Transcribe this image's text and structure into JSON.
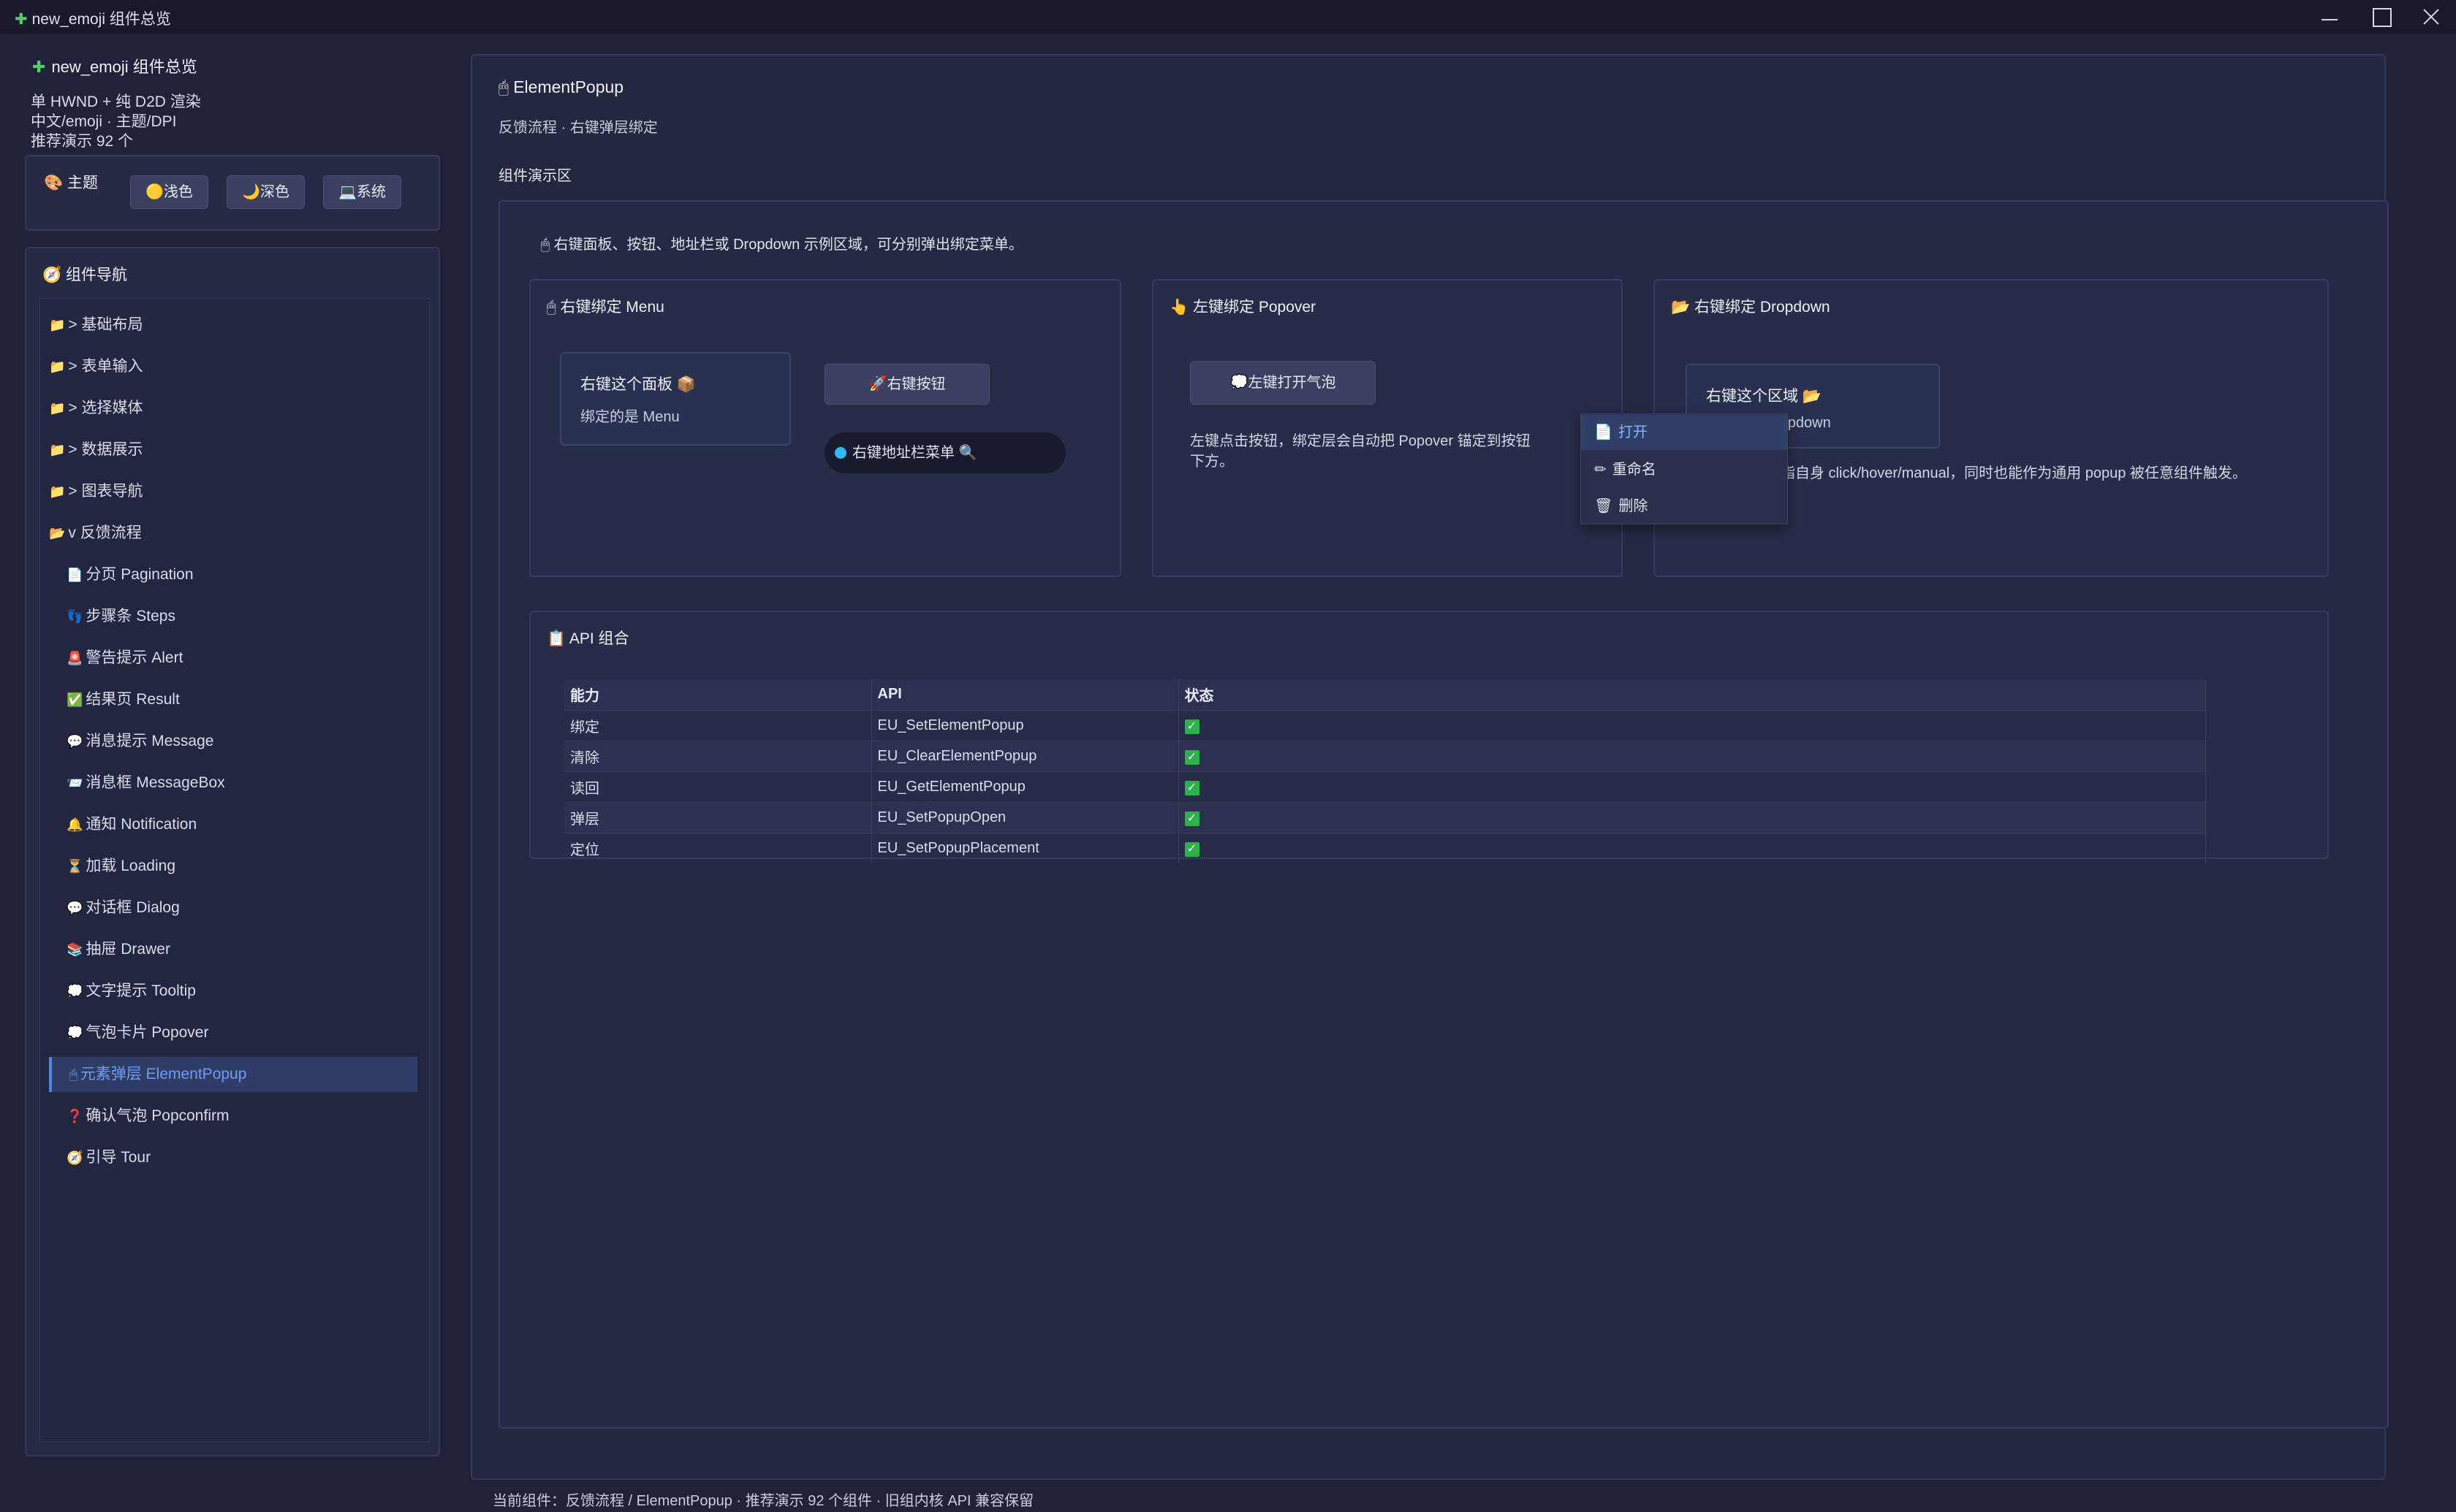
{
  "window": {
    "title": "new_emoji 组件总览"
  },
  "sidebar": {
    "title": "new_emoji 组件总览",
    "info": [
      "单 HWND + 纯 D2D 渲染",
      "中文/emoji · 主题/DPI",
      "推荐演示 92 个"
    ],
    "theme": {
      "label": "主题",
      "light": "浅色",
      "dark": "深色",
      "system": "系统"
    },
    "nav_header": "组件导航",
    "groups": [
      {
        "label": "> 基础布局"
      },
      {
        "label": "> 表单输入"
      },
      {
        "label": "> 选择媒体"
      },
      {
        "label": "> 数据展示"
      },
      {
        "label": "> 图表导航"
      },
      {
        "label": "v 反馈流程"
      }
    ],
    "children": [
      {
        "icon": "📄",
        "label": "分页 Pagination"
      },
      {
        "icon": "👣",
        "label": "步骤条 Steps"
      },
      {
        "icon": "🚨",
        "label": "警告提示 Alert"
      },
      {
        "icon": "✅",
        "label": "结果页 Result"
      },
      {
        "icon": "💬",
        "label": "消息提示 Message"
      },
      {
        "icon": "📨",
        "label": "消息框 MessageBox"
      },
      {
        "icon": "🔔",
        "label": "通知 Notification"
      },
      {
        "icon": "⏳",
        "label": "加载 Loading"
      },
      {
        "icon": "💬",
        "label": "对话框 Dialog"
      },
      {
        "icon": "📚",
        "label": "抽屉 Drawer"
      },
      {
        "icon": "💭",
        "label": "文字提示 Tooltip"
      },
      {
        "icon": "💭",
        "label": "气泡卡片 Popover"
      },
      {
        "icon": "🖱",
        "label": "元素弹层 ElementPopup"
      },
      {
        "icon": "❓",
        "label": "确认气泡 Popconfirm"
      },
      {
        "icon": "🧭",
        "label": "引导 Tour"
      }
    ]
  },
  "main": {
    "title": "ElementPopup",
    "subtitle": "反馈流程 · 右键弹层绑定",
    "demo_label": "组件演示区",
    "demo_desc": "右键面板、按钮、地址栏或 Dropdown 示例区域，可分别弹出绑定菜单。",
    "card_menu": {
      "title": "右键绑定 Menu",
      "panel_title": "右键这个面板",
      "panel_sub": "绑定的是 Menu",
      "button": "右键按钮",
      "address": "右键地址栏菜单"
    },
    "card_popover": {
      "title": "左键绑定 Popover",
      "button": "左键打开气泡",
      "desc_line1": "左键点击按钮，绑定层会自动把 Popover 锚定到按钮",
      "desc_line2": "下方。"
    },
    "card_dropdown": {
      "title": "右键绑定 Dropdown",
      "area_title": "右键这个区域",
      "area_sub": "ropdown",
      "desc": "脂自身 click/hover/manual，同时也能作为通用 popup 被任意组件触发。"
    },
    "context_menu": [
      {
        "icon": "📄",
        "label": "打开"
      },
      {
        "icon": "✏",
        "label": "重命名"
      },
      {
        "icon": "🗑",
        "label": "删除"
      }
    ],
    "api": {
      "title": "API 组合",
      "columns": [
        "能力",
        "API",
        "状态"
      ],
      "rows": [
        {
          "cap": "绑定",
          "api": "EU_SetElementPopup",
          "status": "✓"
        },
        {
          "cap": "清除",
          "api": "EU_ClearElementPopup",
          "status": "✓"
        },
        {
          "cap": "读回",
          "api": "EU_GetElementPopup",
          "status": "✓"
        },
        {
          "cap": "弹层",
          "api": "EU_SetPopupOpen",
          "status": "✓"
        },
        {
          "cap": "定位",
          "api": "EU_SetPopupPlacement",
          "status": "✓"
        }
      ]
    }
  },
  "status_bar": "当前组件：反馈流程 / ElementPopup · 推荐演示 92 个组件 · 旧组内核 API 兼容保留"
}
